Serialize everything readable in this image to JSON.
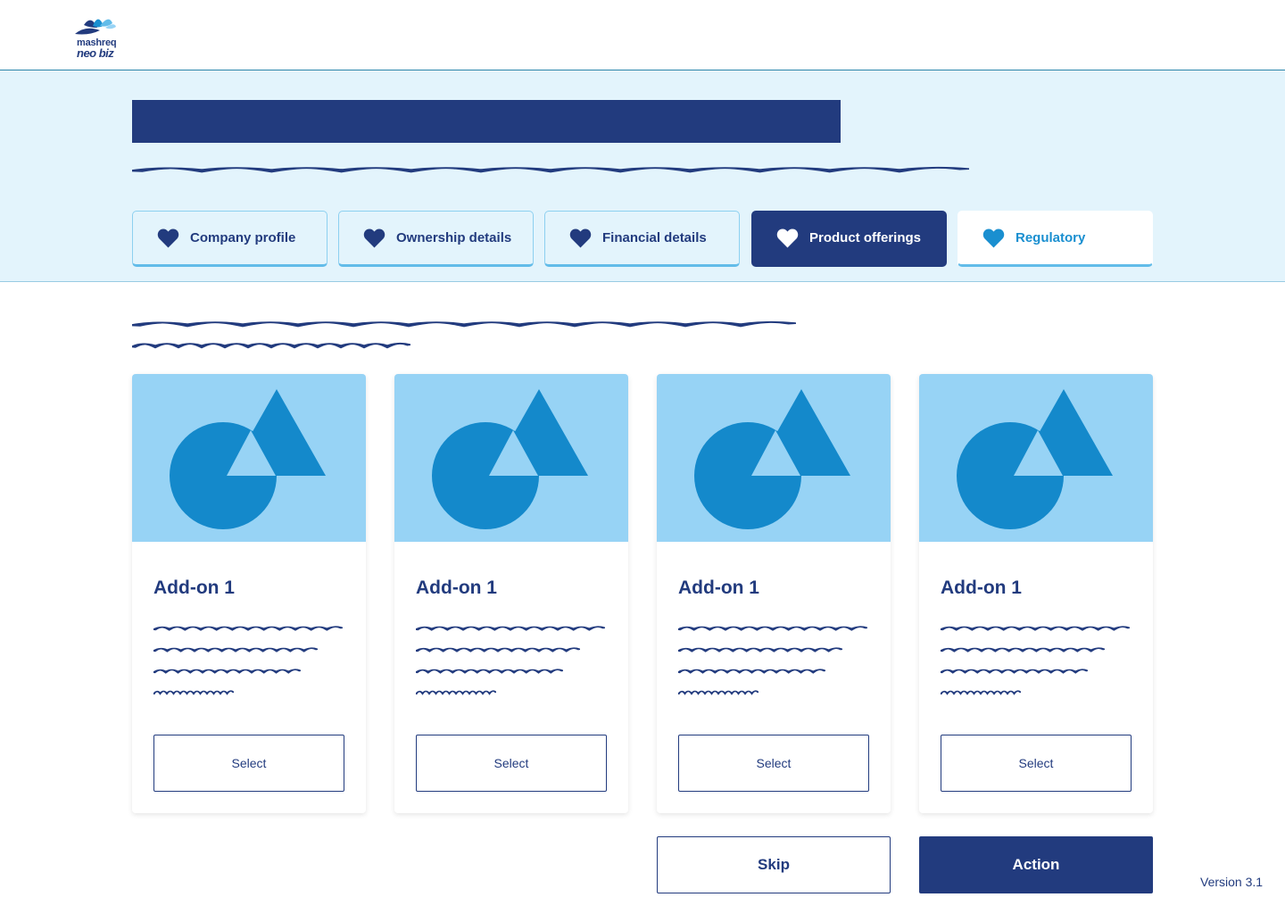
{
  "brand": {
    "line1": "mashreq",
    "line2": "neo biz"
  },
  "colors": {
    "navy": "#223B7E",
    "band": "#E3F4FC",
    "accent": "#1A8FD0",
    "media": "#97D3F5",
    "shape": "#1489CB"
  },
  "tabs": [
    {
      "label": "Company profile",
      "icon": "heart-icon",
      "state": "done"
    },
    {
      "label": "Ownership details",
      "icon": "heart-icon",
      "state": "done"
    },
    {
      "label": "Financial details",
      "icon": "heart-icon",
      "state": "done"
    },
    {
      "label": "Product offerings",
      "icon": "heart-icon",
      "state": "active"
    },
    {
      "label": "Regulatory",
      "icon": "heart-icon",
      "state": "upcoming"
    }
  ],
  "cards": [
    {
      "title": "Add-on 1",
      "button": "Select",
      "icon": "shapes-placeholder-icon"
    },
    {
      "title": "Add-on 1",
      "button": "Select",
      "icon": "shapes-placeholder-icon"
    },
    {
      "title": "Add-on 1",
      "button": "Select",
      "icon": "shapes-placeholder-icon"
    },
    {
      "title": "Add-on 1",
      "button": "Select",
      "icon": "shapes-placeholder-icon"
    }
  ],
  "actions": {
    "skip": "Skip",
    "primary": "Action"
  },
  "version": "Version 3.1"
}
